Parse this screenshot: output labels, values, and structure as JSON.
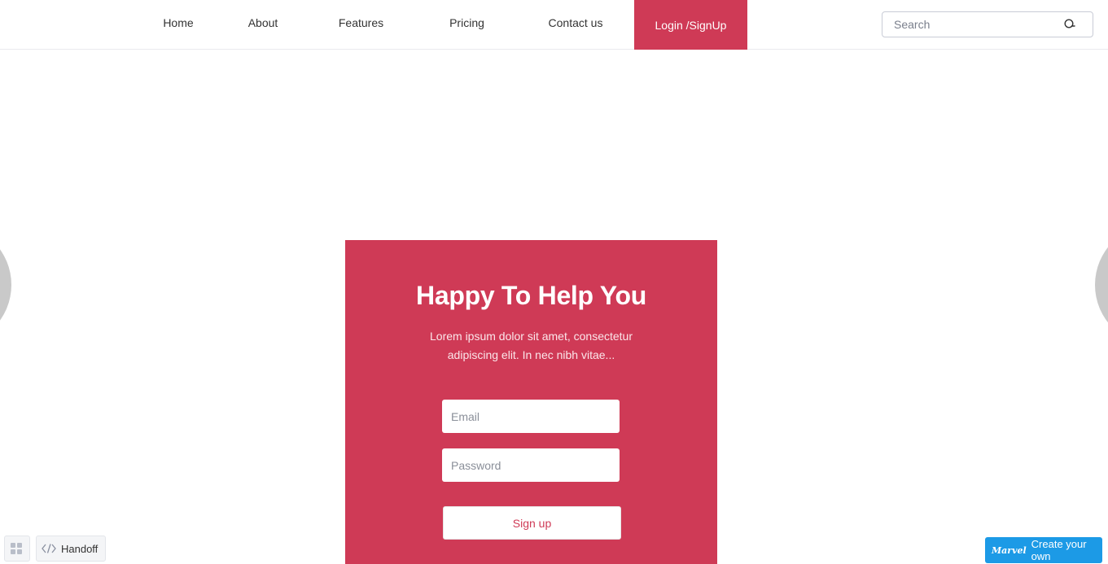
{
  "colors": {
    "accent": "#cf3a56",
    "promo": "#1c9ae6"
  },
  "nav": {
    "items": [
      {
        "label": "Home"
      },
      {
        "label": "About"
      },
      {
        "label": "Features"
      },
      {
        "label": "Pricing"
      },
      {
        "label": "Contact us"
      }
    ],
    "login_label": "Login /SignUp"
  },
  "search": {
    "placeholder": "Search",
    "icon": "search-icon"
  },
  "card": {
    "title": "Happy To Help You",
    "description_line1": "Lorem ipsum dolor sit amet, consectetur",
    "description_line2": "adipiscing elit. In nec nibh vitae...",
    "email_placeholder": "Email",
    "password_placeholder": "Password",
    "signup_label": "Sign up"
  },
  "toolbar": {
    "grid_icon": "grid-icon",
    "handoff_label": "Handoff",
    "handoff_icon": "code-icon"
  },
  "promo": {
    "brand": "Marvel",
    "label": "Create your own"
  }
}
